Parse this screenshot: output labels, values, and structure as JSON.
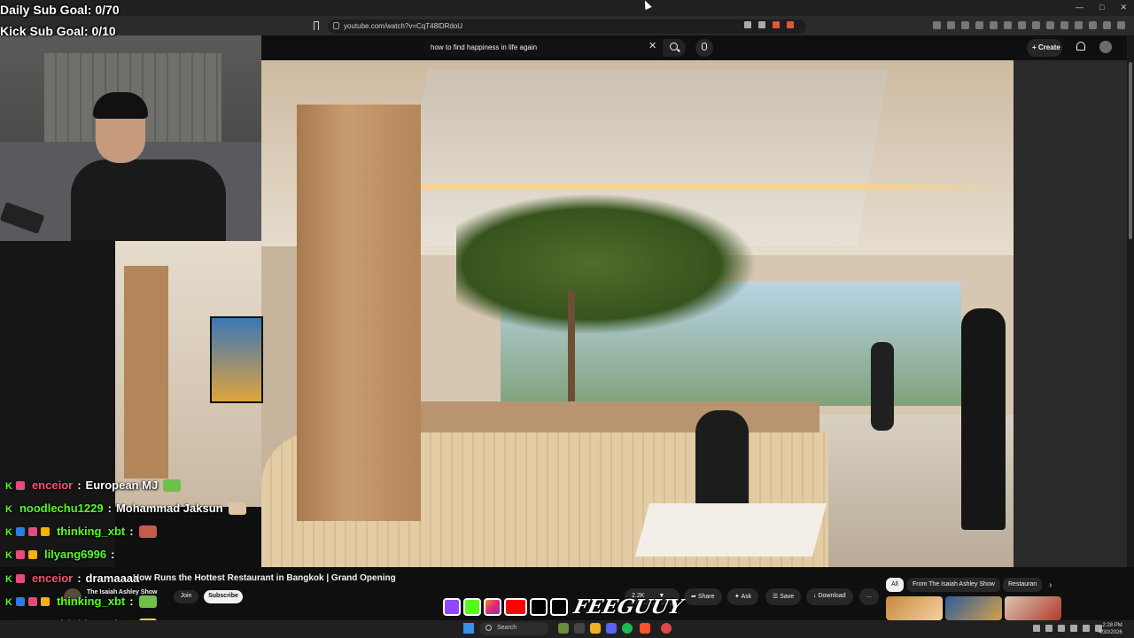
{
  "stream_overlay": {
    "daily_sub_goal": "Daily Sub Goal: 0/70",
    "kick_sub_goal": "Kick Sub Goal: 0/10"
  },
  "browser": {
    "url": "youtube.com/watch?v=CqT48lDRdoU"
  },
  "youtube": {
    "search_query": "how to find happiness in life again",
    "create_label": "Create",
    "video_title": "How Runs the Hottest Restaurant in Bangkok | Grand Opening",
    "channel_name": "The Isaiah Ashley Show",
    "join_label": "Join",
    "subscribe_label": "Subscribe",
    "like_count": "2.2K",
    "share_label": "Share",
    "ask_label": "Ask",
    "save_label": "Save",
    "download_label": "Download",
    "more_label": "...",
    "filter_chips": [
      "All",
      "From The Isaiah Ashley Show",
      "Restauran"
    ]
  },
  "chat": [
    {
      "user": "enceior",
      "user_color": "#ff4d6d",
      "message": "European MJ",
      "badges": [
        "k",
        "heart"
      ],
      "emote_color": "#6fbf4a"
    },
    {
      "user": "noodlechu1229",
      "user_color": "#53fc18",
      "message": "Mohammad Jaksun",
      "badges": [
        "k"
      ],
      "emote_color": "#e0c2a5"
    },
    {
      "user": "thinking_xbt",
      "user_color": "#53fc18",
      "message": "",
      "badges": [
        "k",
        "sword",
        "heart",
        "crown"
      ],
      "emote_color": "#c55b4a"
    },
    {
      "user": "lilyang6996",
      "user_color": "#53fc18",
      "message": "",
      "badges": [
        "k",
        "heart",
        "crown"
      ],
      "emote_color": ""
    },
    {
      "user": "enceior",
      "user_color": "#ff4d6d",
      "message": "dramaaaa",
      "badges": [
        "k",
        "heart"
      ],
      "emote_color": ""
    },
    {
      "user": "thinking_xbt",
      "user_color": "#53fc18",
      "message": "",
      "badges": [
        "k",
        "sword",
        "heart",
        "crown"
      ],
      "emote_color": "#6fbf4a"
    },
    {
      "user": "thinking_xbt",
      "user_color": "#53fc18",
      "message": "",
      "badges": [
        "k",
        "sword",
        "heart",
        "crown"
      ],
      "emote_color": "#f4d03f"
    }
  ],
  "taskbar": {
    "search_placeholder": "Search",
    "time": "2:28 PM",
    "date": "4/30/2026"
  },
  "brand_logo": "FEEGUUY",
  "colors": {
    "kick_green": "#53fc18",
    "youtube_red": "#ff0000",
    "twitch_purple": "#9146ff"
  }
}
